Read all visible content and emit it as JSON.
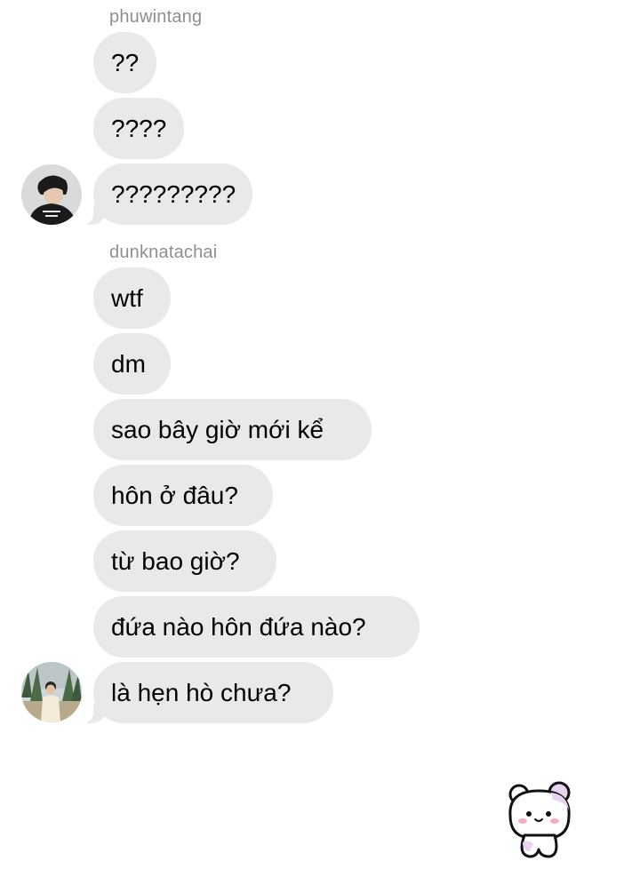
{
  "groups": [
    {
      "sender": "phuwintang",
      "avatar": "phuwintang-avatar",
      "messages": [
        "??",
        "????",
        "?????????"
      ]
    },
    {
      "sender": "dunknatachai",
      "avatar": "dunknatachai-avatar",
      "messages": [
        "wtf",
        "dm",
        "sao bây giờ mới kể",
        "hôn ở đâu?",
        "từ bao giờ?",
        "đứa nào hôn đứa nào?",
        "là hẹn hò chưa?"
      ]
    }
  ],
  "sticker": "bear-sticker-icon",
  "colors": {
    "bubble": "#e9e9eb",
    "sender_name": "#8e8e93",
    "text": "#000000"
  }
}
